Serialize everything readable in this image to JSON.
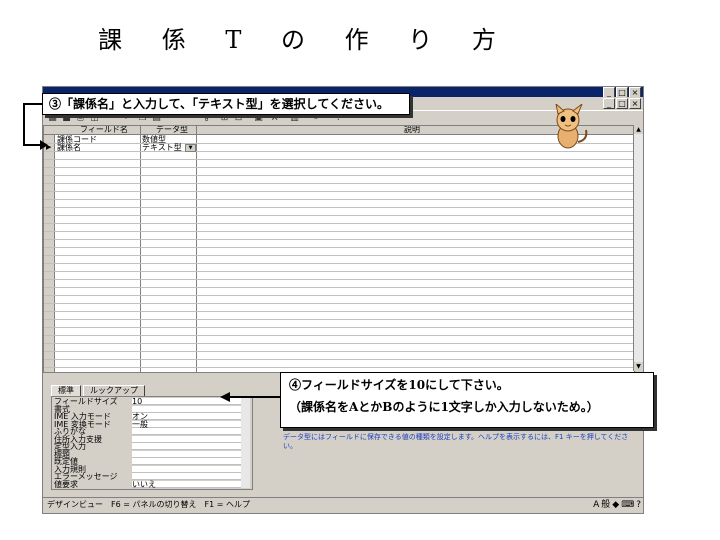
{
  "slide": {
    "title": "課 係 T の 作 り 方"
  },
  "window": {
    "toolbar_icons": [
      "table-view-icon",
      "save-icon",
      "print-icon",
      "preview-icon",
      "cut-icon",
      "copy-icon",
      "paste-icon",
      "undo-icon",
      "key-icon",
      "insert-row-icon",
      "delete-row-icon",
      "properties-icon",
      "build-icon",
      "database-window-icon",
      "new-object-icon",
      "help-icon"
    ]
  },
  "design_grid": {
    "headers": {
      "field_name": "フィールド名",
      "data_type": "データ型",
      "description": "説明"
    },
    "rows": [
      {
        "marker": "",
        "field_name": "課係コード",
        "data_type": "数値型"
      },
      {
        "marker": "▶",
        "field_name": "課係名",
        "data_type": "テキスト型"
      }
    ]
  },
  "properties": {
    "tabs": [
      "標準",
      "ルックアップ"
    ],
    "rows": [
      {
        "label": "フィールドサイズ",
        "value": "10"
      },
      {
        "label": "書式",
        "value": ""
      },
      {
        "label": "IME 入力モード",
        "value": "オン"
      },
      {
        "label": "IME 変換モード",
        "value": "一般"
      },
      {
        "label": "ふりがな",
        "value": ""
      },
      {
        "label": "住所入力支援",
        "value": ""
      },
      {
        "label": "定型入力",
        "value": ""
      },
      {
        "label": "標題",
        "value": ""
      },
      {
        "label": "既定値",
        "value": ""
      },
      {
        "label": "入力規則",
        "value": ""
      },
      {
        "label": "エラーメッセージ",
        "value": ""
      },
      {
        "label": "値要求",
        "value": "いいえ"
      }
    ],
    "hint": "データ型にはフィールドに保存できる値の種類を設定します。ヘルプを表示するには、F1 キーを押してください。"
  },
  "statusbar": {
    "text": "デザインビュー　F6 = パネルの切り替え　F1 = ヘルプ",
    "ime": "般"
  },
  "callouts": {
    "step3": "③「課係名」と入力して、「テキスト型」を選択してください。",
    "step4_line1": "④フィールドサイズを10にして下さい。",
    "step4_line2": "（課係名をAとかBのように1文字しか入力しないため。）"
  }
}
